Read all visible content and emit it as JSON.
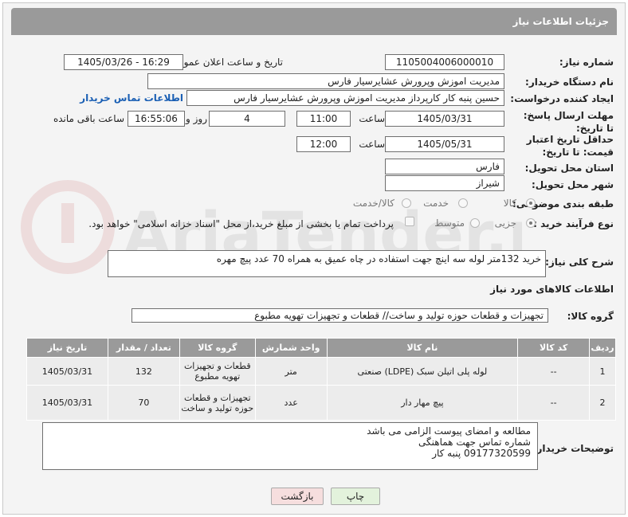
{
  "header": {
    "title": "جزئیات اطلاعات نیاز"
  },
  "fields": {
    "need_number": {
      "label": "شماره نیاز:",
      "value": "1105004006000010"
    },
    "announce": {
      "label": "تاریخ و ساعت اعلان عمومی:",
      "value": "1405/03/26 - 16:29"
    },
    "buyer_org": {
      "label": "نام دستگاه خریدار:",
      "value": "مدیریت اموزش وپرورش عشایرسیار فارس"
    },
    "requester": {
      "label": "ایجاد کننده درخواست:",
      "value": "حسین پنبه کار کارپرداز مدیریت اموزش وپرورش عشایرسیار فارس",
      "contact_link": "اطلاعات تماس خریدار"
    },
    "deadline": {
      "label": "مهلت ارسال پاسخ: تا تاریخ:",
      "date": "1405/03/31",
      "time_label": "ساعت",
      "time": "11:00",
      "days": "4",
      "days_label": "روز و",
      "remaining": "16:55:06",
      "remaining_label": "ساعت باقی مانده"
    },
    "validity": {
      "label": "حداقل تاریخ اعتبار قیمت: تا تاریخ:",
      "date": "1405/05/31",
      "time_label": "ساعت",
      "time": "12:00"
    },
    "province": {
      "label": "استان محل تحویل:",
      "value": "فارس"
    },
    "city": {
      "label": "شهر محل تحویل:",
      "value": "شیراز"
    },
    "category": {
      "label": "طبقه بندی موضوعی:",
      "options": [
        "کالا",
        "خدمت",
        "کالا/خدمت"
      ]
    },
    "process": {
      "label": "نوع فرآیند خرید :",
      "options": [
        "جزیی",
        "متوسط"
      ],
      "payment_note": "پرداخت تمام یا بخشی از مبلغ خرید،از محل \"اسناد خزانه اسلامی\" خواهد بود."
    }
  },
  "description": {
    "label": "شرح کلی نیاز:",
    "value": "خرید 132متر لوله سه اینچ جهت استفاده در چاه عمیق به همراه 70  عدد پیچ مهره"
  },
  "goods": {
    "section_title": "اطلاعات کالاهای مورد نیاز",
    "group_label": "گروه کالا:",
    "group_value": "تجهیزات و قطعات حوزه تولید و ساخت//  قطعات و تجهیزات تهویه مطبوع",
    "columns": [
      "ردیف",
      "کد کالا",
      "نام کالا",
      "واحد شمارش",
      "گروه کالا",
      "تعداد / مقدار",
      "تاریخ نیاز"
    ],
    "rows": [
      {
        "row": "1",
        "code": "--",
        "name": "لوله پلی اتیلن سبک (LDPE) صنعتی",
        "unit": "متر",
        "group": "قطعات و تجهیزات تهویه مطبوع",
        "qty": "132",
        "date": "1405/03/31"
      },
      {
        "row": "2",
        "code": "--",
        "name": "پیچ مهار دار",
        "unit": "عدد",
        "group": "تجهیزات و قطعات حوزه تولید و ساخت",
        "qty": "70",
        "date": "1405/03/31"
      }
    ]
  },
  "buyer_notes": {
    "label": "توضیحات خریدار:",
    "lines": [
      "مطالعه و امضای پیوست  الزامی می باشد",
      "شماره تماس جهت هماهنگی",
      "09177320599    پنبه کار"
    ]
  },
  "buttons": {
    "print": "چاپ",
    "back": "بازگشت"
  },
  "watermark": "AriaTender.net"
}
